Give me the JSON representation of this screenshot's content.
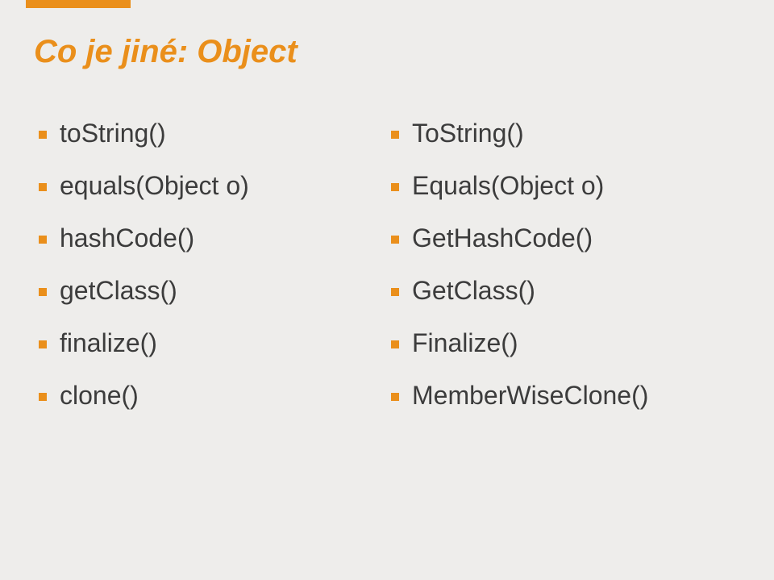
{
  "title": "Co je jiné: Object",
  "left": [
    "toString()",
    "equals(Object o)",
    "hashCode()",
    "getClass()",
    "finalize()",
    "clone()"
  ],
  "right": [
    "ToString()",
    "Equals(Object o)",
    "GetHashCode()",
    "GetClass()",
    "Finalize()",
    "MemberWiseClone()"
  ]
}
